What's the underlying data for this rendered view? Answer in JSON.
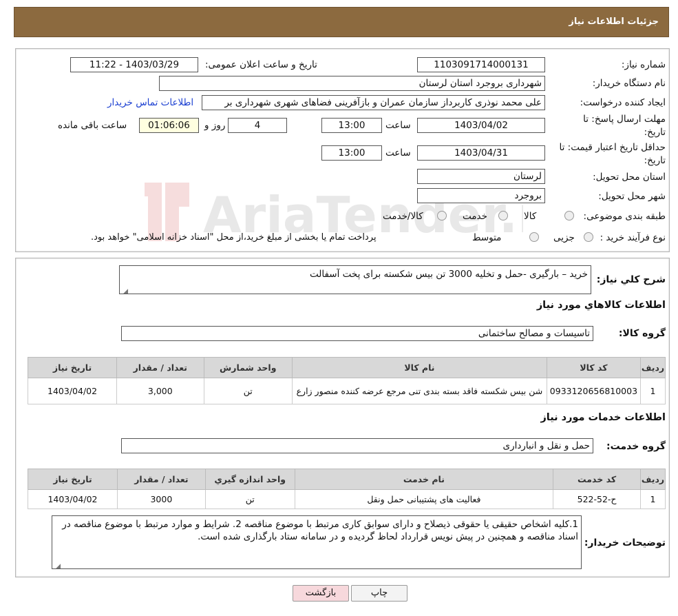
{
  "header": {
    "title": "جزئیات اطلاعات نیاز"
  },
  "info": {
    "need_number_label": "شماره نیاز:",
    "need_number": "1103091714000131",
    "announce_label": "تاریخ و ساعت اعلان عمومی:",
    "announce_value": "1403/03/29 - 11:22",
    "buyer_org_label": "نام دستگاه خریدار:",
    "buyer_org": "شهرداری بروجرد استان لرستان",
    "creator_label": "ایجاد کننده درخواست:",
    "creator": "علی محمد نوذری کاربرداز سازمان عمران و بازآفرینی فضاهای شهری شهرداری بر",
    "contact_link": "اطلاعات تماس خریدار",
    "deadline_label_1": "مهلت ارسال پاسخ: تا",
    "deadline_label_2": "تاریخ:",
    "deadline_date": "1403/04/02",
    "time_label": "ساعت",
    "deadline_time": "13:00",
    "days_value": "4",
    "days_label": "روز و",
    "remaining_time": "01:06:06",
    "remaining_label": "ساعت باقی مانده",
    "validity_label_1": "حداقل تاریخ اعتبار قیمت: تا",
    "validity_label_2": "تاریخ:",
    "validity_date": "1403/04/31",
    "validity_time": "13:00",
    "province_label": "استان محل تحویل:",
    "province": "لرستان",
    "city_label": "شهر محل تحویل:",
    "city": "بروجرد",
    "category_label": "طبقه بندی موضوعی:",
    "category_options": [
      "کالا",
      "خدمت",
      "کالا/خدمت"
    ],
    "process_label": "نوع فرآیند خرید :",
    "process_options": [
      "جزیی",
      "متوسط"
    ],
    "process_note": "پرداخت تمام یا بخشی از مبلغ خرید،از محل \"اسناد خزانه اسلامی\" خواهد بود."
  },
  "summary": {
    "label": "شرح کلي نياز:",
    "value": "خرید – بارگیری -حمل و تخلیه  3000  تن بیس شکسته  برای پخت آسفالت"
  },
  "goods": {
    "section_title": "اطلاعات کالاهاي مورد نياز",
    "group_label": "گروه کالا:",
    "group_value": "تاسیسات و مصالح ساختمانی",
    "headers": [
      "رديف",
      "کد کالا",
      "نام کالا",
      "واحد شمارش",
      "تعداد / مقدار",
      "تاريخ نياز"
    ],
    "rows": [
      [
        "1",
        "0933120656810003",
        "شن بیس شکسته فاقد بسته بندی تنی مرجع عرضه کننده منصور زارع",
        "تن",
        "3,000",
        "1403/04/02"
      ]
    ]
  },
  "services": {
    "section_title": "اطلاعات خدمات مورد نياز",
    "group_label": "گروه خدمت:",
    "group_value": "حمل و نقل و انبارداری",
    "headers": [
      "رديف",
      "کد خدمت",
      "نام خدمت",
      "واحد اندازه گيري",
      "تعداد / مقدار",
      "تاريخ نياز"
    ],
    "rows": [
      [
        "1",
        "ح-52-522",
        "فعالیت های پشتیبانی حمل ونقل",
        "تن",
        "3000",
        "1403/04/02"
      ]
    ]
  },
  "buyer_notes": {
    "label": "توضیحات خریدار:",
    "value": "1.کلیه اشخاص حقیقی یا حقوقی ذیصلاح و دارای سوابق کاری مرتبط با موضوع مناقصه 2. شرایط و موارد مرتبط با موضوع مناقصه در اسناد مناقصه  و همچنین در پیش نویس قرارداد لحاظ گردیده و در سامانه ستاد بارگذاری شده است."
  },
  "buttons": {
    "print": "چاپ",
    "back": "بازگشت"
  },
  "watermark": {
    "text": "AriaTender.neT"
  },
  "colors": {
    "header_bg": "#8c6a3f",
    "link": "#1b3fd1",
    "back_button_bg": "#f7d8dc",
    "yellow_box": "#ffffe0"
  }
}
